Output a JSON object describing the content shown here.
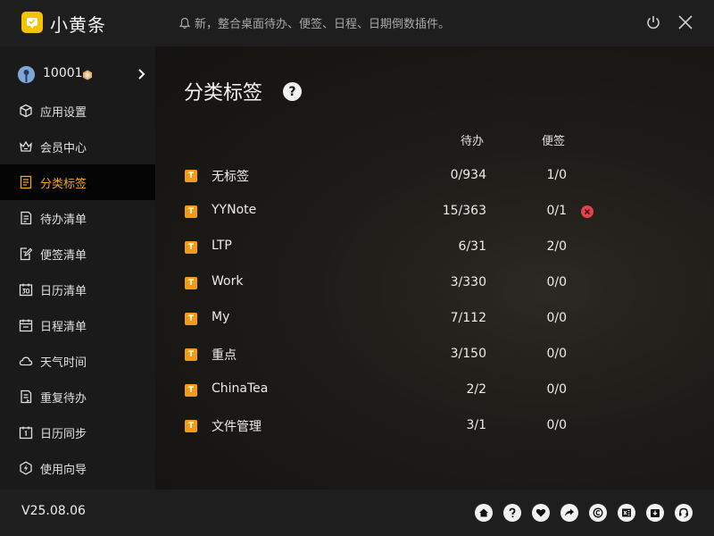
{
  "app": {
    "name": "小黄条",
    "notice": "新，整合桌面待办、便签、日程、日期倒数插件。"
  },
  "user": {
    "id": "10001"
  },
  "sidebar": {
    "items": [
      {
        "label": "应用设置",
        "icon": "settings-cube-icon"
      },
      {
        "label": "会员中心",
        "icon": "crown-icon"
      },
      {
        "label": "分类标签",
        "icon": "tag-list-icon",
        "active": true
      },
      {
        "label": "待办清单",
        "icon": "todo-list-icon"
      },
      {
        "label": "便签清单",
        "icon": "note-edit-icon"
      },
      {
        "label": "日历清单",
        "icon": "calendar-30-icon"
      },
      {
        "label": "日程清单",
        "icon": "schedule-icon"
      },
      {
        "label": "天气时间",
        "icon": "cloud-icon"
      },
      {
        "label": "重复待办",
        "icon": "repeat-icon"
      },
      {
        "label": "日历同步",
        "icon": "calendar-sync-icon"
      },
      {
        "label": "使用向导",
        "icon": "compass-icon"
      }
    ]
  },
  "main": {
    "title": "分类标签",
    "columns": {
      "todo": "待办",
      "note": "便签"
    },
    "tag_glyph": "T",
    "rows": [
      {
        "name": "无标签",
        "todo": "0/934",
        "note": "1/0"
      },
      {
        "name": "YYNote",
        "todo": "15/363",
        "note": "0/1",
        "deletable": true
      },
      {
        "name": "LTP",
        "todo": "6/31",
        "note": "2/0"
      },
      {
        "name": "Work",
        "todo": "3/330",
        "note": "0/0"
      },
      {
        "name": "My",
        "todo": "7/112",
        "note": "0/0"
      },
      {
        "name": "重点",
        "todo": "3/150",
        "note": "0/0"
      },
      {
        "name": "ChinaTea",
        "todo": "2/2",
        "note": "0/0"
      },
      {
        "name": "文件管理",
        "todo": "3/1",
        "note": "0/0"
      }
    ]
  },
  "footer": {
    "version": "V25.08.06",
    "icons": [
      "home-icon",
      "help-icon",
      "heart-icon",
      "share-icon",
      "copyright-icon",
      "excel-export-icon",
      "import-icon",
      "support-icon"
    ]
  },
  "colors": {
    "accent": "#f5a623",
    "tag": "#f39c12",
    "delete": "#e0434b",
    "logo": "#f5c400"
  }
}
